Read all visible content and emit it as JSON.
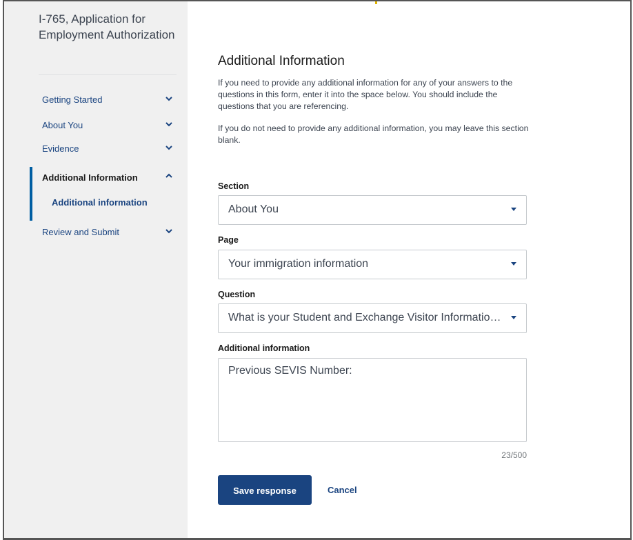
{
  "sidebar": {
    "form_title": "I-765, Application for Employment Authorization",
    "items": [
      {
        "label": "Getting Started"
      },
      {
        "label": "About You"
      },
      {
        "label": "Evidence"
      },
      {
        "label": "Additional Information",
        "sub_label": "Additional information"
      },
      {
        "label": "Review and Submit"
      }
    ]
  },
  "main": {
    "title": "Additional Information",
    "intro_1": "If you need to provide any additional information for any of your answers to the questions in this form, enter it into the space below. You should include the questions that you are referencing.",
    "intro_2": "If you do not need to provide any additional information, you may leave this section blank.",
    "section": {
      "label": "Section",
      "value": "About You"
    },
    "page": {
      "label": "Page",
      "value": "Your immigration information"
    },
    "question": {
      "label": "Question",
      "value": "What is your Student and Exchange Visitor Information System (SEVIS) number?"
    },
    "additional": {
      "label": "Additional information",
      "value": "Previous SEVIS Number:",
      "counter": "23/500"
    },
    "save_label": "Save response",
    "cancel_label": "Cancel"
  },
  "colors": {
    "primary": "#1a4480",
    "active_bar": "#005ea2",
    "sidebar_bg": "#f0f0f0"
  }
}
